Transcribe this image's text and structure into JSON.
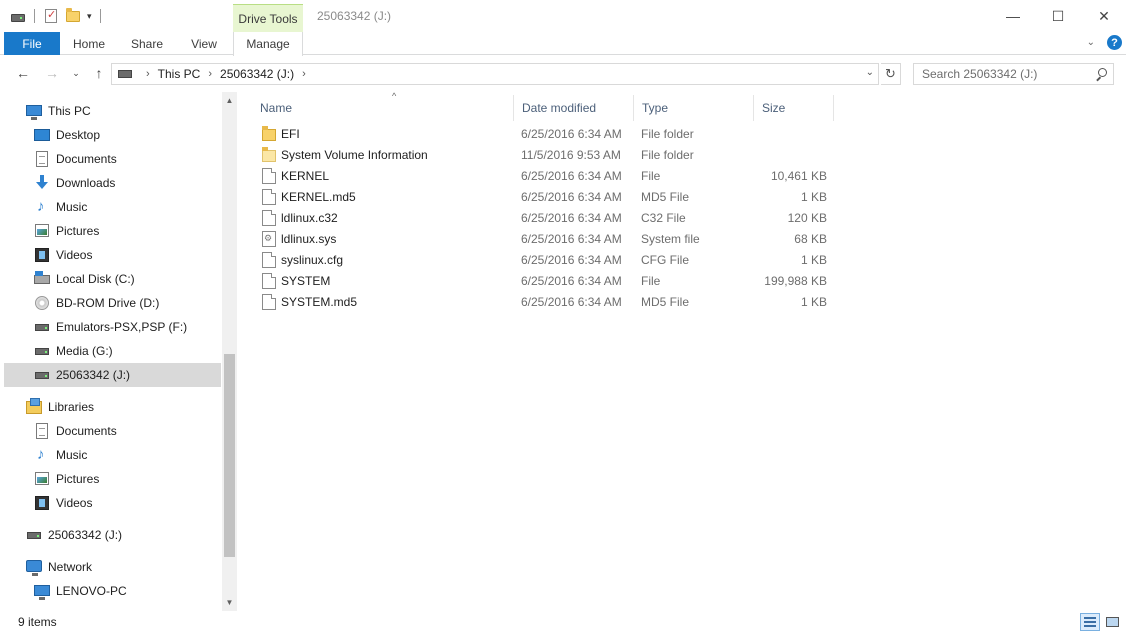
{
  "window": {
    "title": "25063342 (J:)",
    "contextual_tab": "Drive Tools",
    "minimize": "—",
    "maximize": "☐",
    "close": "✕"
  },
  "ribbon": {
    "tabs": [
      "File",
      "Home",
      "Share",
      "View",
      "Manage"
    ],
    "help": "?"
  },
  "address": {
    "crumbs": [
      "This PC",
      "25063342 (J:)"
    ],
    "search_placeholder": "Search 25063342 (J:)"
  },
  "nav": {
    "items": [
      {
        "label": "This PC",
        "icon": "pc-icon",
        "level": 0
      },
      {
        "label": "Desktop",
        "icon": "desktop-icon",
        "level": 1
      },
      {
        "label": "Documents",
        "icon": "documents-icon",
        "level": 1
      },
      {
        "label": "Downloads",
        "icon": "downloads-icon",
        "level": 1
      },
      {
        "label": "Music",
        "icon": "music-icon",
        "level": 1
      },
      {
        "label": "Pictures",
        "icon": "pictures-icon",
        "level": 1
      },
      {
        "label": "Videos",
        "icon": "videos-icon",
        "level": 1
      },
      {
        "label": "Local Disk (C:)",
        "icon": "local-disk-icon",
        "level": 1
      },
      {
        "label": "BD-ROM Drive (D:)",
        "icon": "bd-rom-icon",
        "level": 1
      },
      {
        "label": "Emulators-PSX,PSP (F:)",
        "icon": "drive-icon",
        "level": 1
      },
      {
        "label": "Media (G:)",
        "icon": "drive-icon",
        "level": 1
      },
      {
        "label": "25063342 (J:)",
        "icon": "drive-icon",
        "level": 1,
        "selected": true
      },
      {
        "label": "Libraries",
        "icon": "libraries-icon",
        "level": 0
      },
      {
        "label": "Documents",
        "icon": "documents-icon",
        "level": 1
      },
      {
        "label": "Music",
        "icon": "music-icon",
        "level": 1
      },
      {
        "label": "Pictures",
        "icon": "pictures-icon",
        "level": 1
      },
      {
        "label": "Videos",
        "icon": "videos-icon",
        "level": 1
      },
      {
        "label": "25063342 (J:)",
        "icon": "drive-icon",
        "level": 0
      },
      {
        "label": "Network",
        "icon": "network-icon",
        "level": 0
      },
      {
        "label": "LENOVO-PC",
        "icon": "pc-icon",
        "level": 1
      }
    ]
  },
  "columns": {
    "name": "Name",
    "date": "Date modified",
    "type": "Type",
    "size": "Size"
  },
  "files": [
    {
      "name": "EFI",
      "date": "6/25/2016 6:34 AM",
      "type": "File folder",
      "size": "",
      "icon": "folder-icon"
    },
    {
      "name": "System Volume Information",
      "date": "11/5/2016 9:53 AM",
      "type": "File folder",
      "size": "",
      "icon": "folder-icon"
    },
    {
      "name": "KERNEL",
      "date": "6/25/2016 6:34 AM",
      "type": "File",
      "size": "10,461 KB",
      "icon": "file-icon"
    },
    {
      "name": "KERNEL.md5",
      "date": "6/25/2016 6:34 AM",
      "type": "MD5 File",
      "size": "1 KB",
      "icon": "file-icon"
    },
    {
      "name": "ldlinux.c32",
      "date": "6/25/2016 6:34 AM",
      "type": "C32 File",
      "size": "120 KB",
      "icon": "file-icon"
    },
    {
      "name": "ldlinux.sys",
      "date": "6/25/2016 6:34 AM",
      "type": "System file",
      "size": "68 KB",
      "icon": "system-file-icon"
    },
    {
      "name": "syslinux.cfg",
      "date": "6/25/2016 6:34 AM",
      "type": "CFG File",
      "size": "1 KB",
      "icon": "file-icon"
    },
    {
      "name": "SYSTEM",
      "date": "6/25/2016 6:34 AM",
      "type": "File",
      "size": "199,988 KB",
      "icon": "file-icon"
    },
    {
      "name": "SYSTEM.md5",
      "date": "6/25/2016 6:34 AM",
      "type": "MD5 File",
      "size": "1 KB",
      "icon": "file-icon"
    }
  ],
  "status": {
    "item_count": "9 items"
  }
}
